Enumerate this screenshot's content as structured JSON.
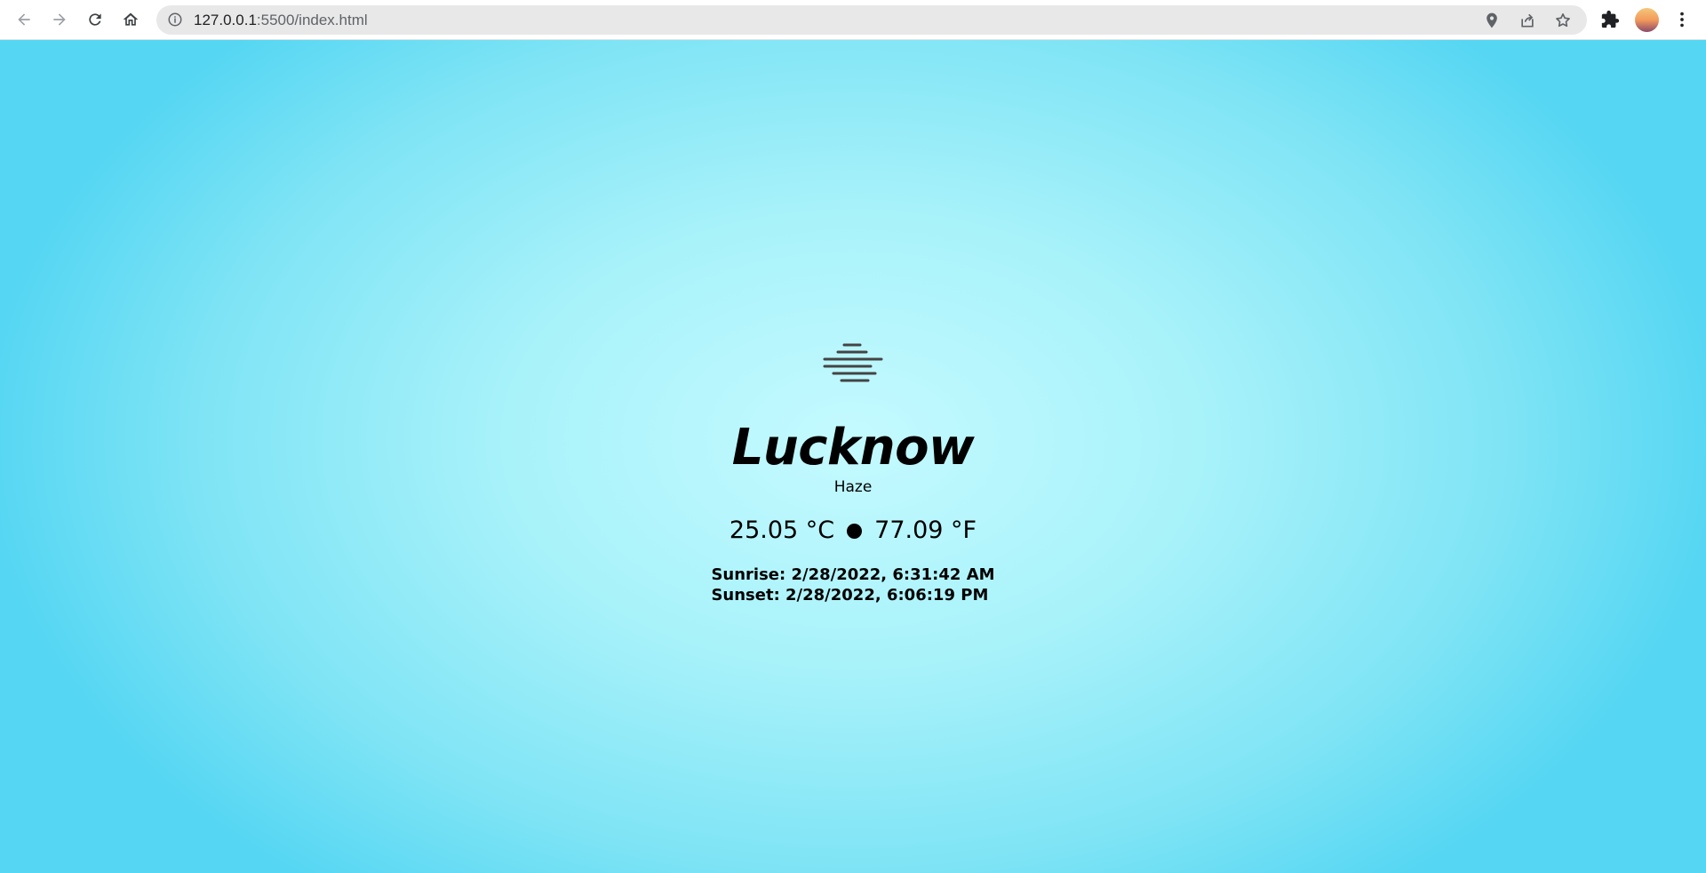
{
  "browser": {
    "url_host": "127.0.0.1",
    "url_rest": ":5500/index.html"
  },
  "weather": {
    "icon": "haze-icon",
    "city": "Lucknow",
    "condition": "Haze",
    "temp_c": "25.05 °C",
    "temp_f": "77.09 °F",
    "sunrise": "Sunrise: 2/28/2022, 6:31:42 AM",
    "sunset": "Sunset: 2/28/2022, 6:06:19 PM"
  },
  "colors": {
    "background_center": "#c4faff",
    "background_edge": "#55d6f3",
    "text": "#000000"
  }
}
